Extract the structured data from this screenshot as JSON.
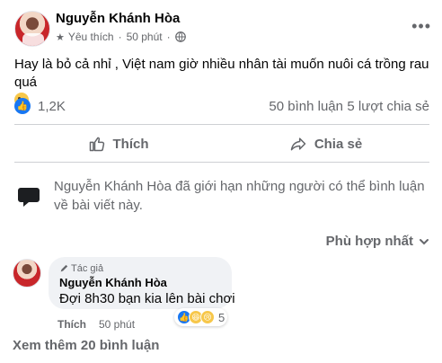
{
  "post": {
    "author": "Nguyễn Khánh Hòa",
    "favorite_label": "Yêu thích",
    "time": "50 phút",
    "text": "Hay là bỏ cả nhỉ , Việt nam giờ nhiều nhân tài muốn nuôi cá trồng rau quá"
  },
  "stats": {
    "reactions": "1,2K",
    "comments": "50 bình luận",
    "shares": "5 lượt chia sẻ"
  },
  "actions": {
    "like": "Thích",
    "share": "Chia sẻ"
  },
  "notice": "Nguyễn Khánh Hòa đã giới hạn những người có thể bình luận về bài viết này.",
  "sort": "Phù hợp nhất",
  "comment": {
    "author_tag": "Tác giả",
    "author": "Nguyễn Khánh Hòa",
    "text": "Đợi 8h30 bạn kia lên bài chơi",
    "reaction_count": "5",
    "like": "Thích",
    "time": "50 phút"
  },
  "more_comments": "Xem thêm 20 bình luận",
  "colors": {
    "accent": "#1877f2",
    "secondary_text": "#65676b",
    "bubble_bg": "#f0f2f5"
  }
}
